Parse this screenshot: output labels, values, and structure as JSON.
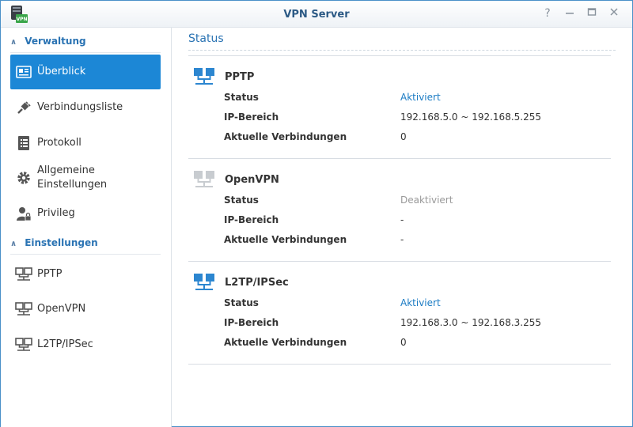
{
  "window": {
    "title": "VPN Server",
    "app_icon_text": "VPN"
  },
  "sidebar": {
    "sections": [
      {
        "label": "Verwaltung"
      },
      {
        "label": "Einstellungen"
      }
    ],
    "items": [
      {
        "label": "Überblick"
      },
      {
        "label": "Verbindungsliste"
      },
      {
        "label": "Protokoll"
      },
      {
        "label": "Allgemeine Einstellungen",
        "line1": "Allgemeine",
        "line2": "Einstellungen"
      },
      {
        "label": "Privileg"
      },
      {
        "label": "PPTP"
      },
      {
        "label": "OpenVPN"
      },
      {
        "label": "L2TP/IPSec"
      }
    ]
  },
  "main": {
    "title": "Status",
    "labels": {
      "status": "Status",
      "ip": "IP-Bereich",
      "conn": "Aktuelle Verbindungen"
    },
    "services": [
      {
        "name": "PPTP",
        "status": "Aktiviert",
        "ip": "192.168.5.0 ~ 192.168.5.255",
        "conn": "0"
      },
      {
        "name": "OpenVPN",
        "status": "Deaktiviert",
        "ip": "-",
        "conn": "-"
      },
      {
        "name": "L2TP/IPSec",
        "status": "Aktiviert",
        "ip": "192.168.3.0 ~ 192.168.3.255",
        "conn": "0"
      }
    ]
  },
  "colors": {
    "accent": "#1c87d6",
    "active_status": "#1c7cc4",
    "inactive_status": "#999999"
  }
}
